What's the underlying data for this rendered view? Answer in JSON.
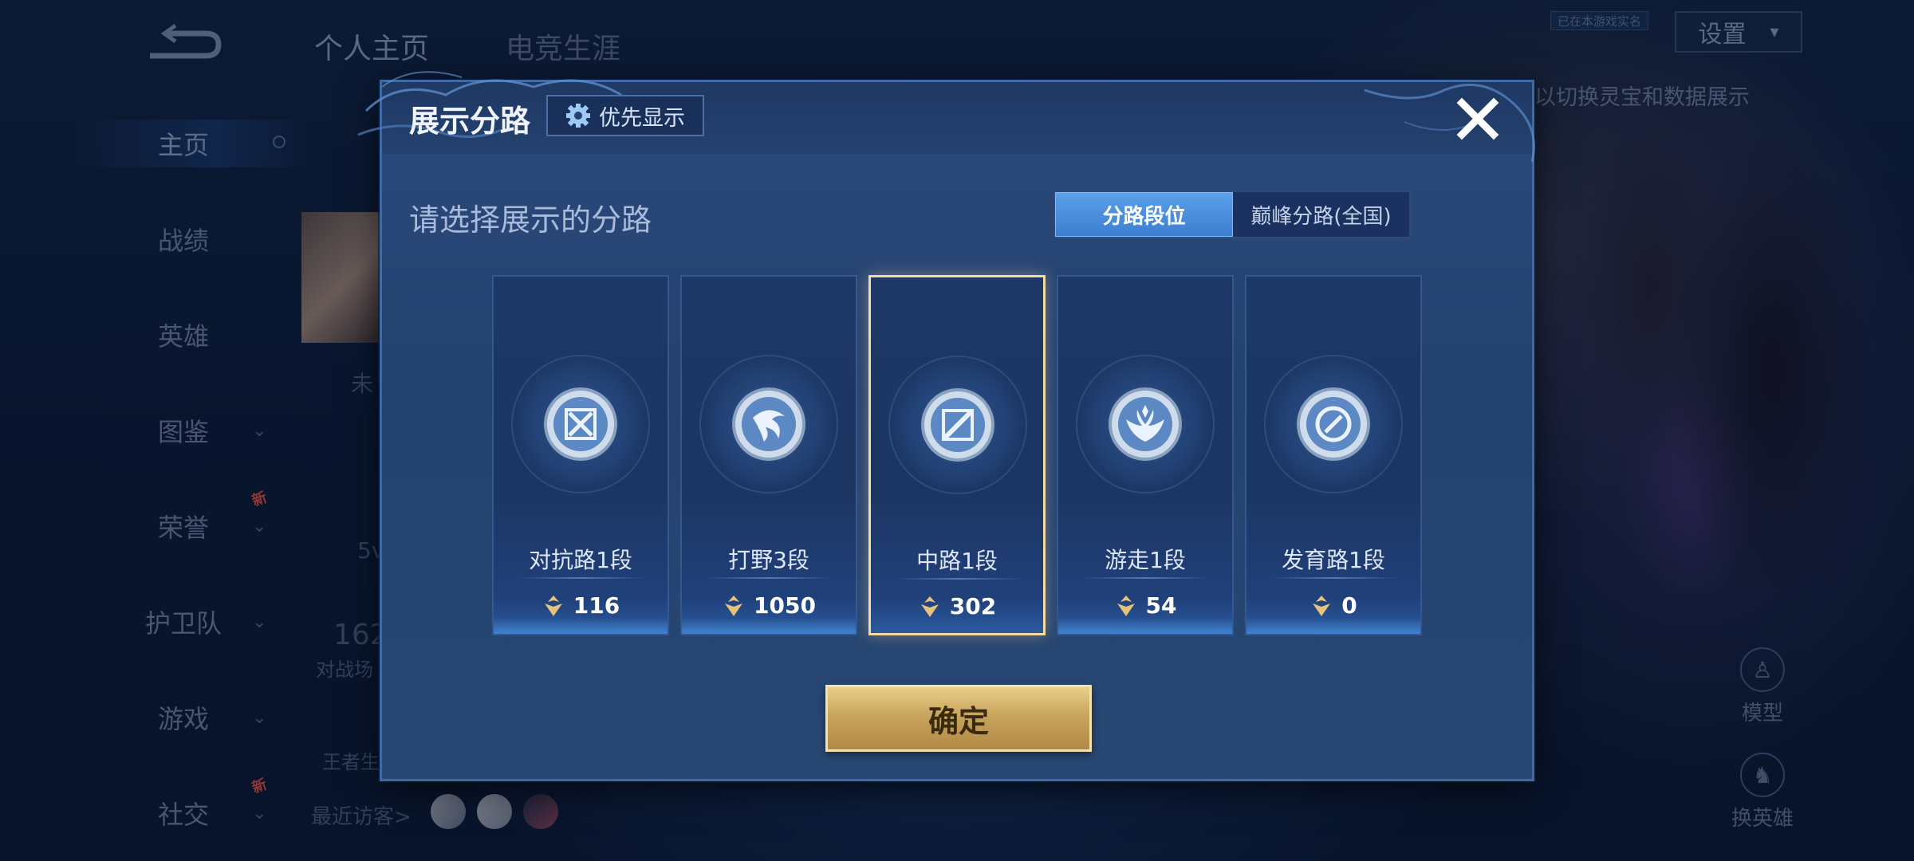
{
  "sidebar": {
    "items": [
      {
        "label": "主页",
        "active": true
      },
      {
        "label": "战绩"
      },
      {
        "label": "英雄"
      },
      {
        "label": "图鉴",
        "has_chevron": true
      },
      {
        "label": "荣誉",
        "has_chevron": true,
        "badge": "新"
      },
      {
        "label": "护卫队",
        "has_chevron": true
      },
      {
        "label": "游戏",
        "has_chevron": true
      },
      {
        "label": "社交",
        "has_chevron": true,
        "badge": "新"
      }
    ]
  },
  "top_tabs": [
    "个人主页",
    "电竞生涯"
  ],
  "header": {
    "settings_label": "设置",
    "small_tag": "已在本游戏实名",
    "tip": "以切换灵宝和数据展示"
  },
  "behind": {
    "peek_1": "未",
    "peek_2": "5v",
    "peek_3": "162",
    "peek_4": "对战场",
    "peek_5": "王者生",
    "recent_visitors": "最近访客>"
  },
  "right_icons": {
    "model": "模型",
    "switch_hero": "换英雄"
  },
  "modal": {
    "title": "展示分路",
    "priority_label": "优先显示",
    "prompt": "请选择展示的分路",
    "segment": {
      "options": [
        "分路段位",
        "巅峰分路(全国)"
      ],
      "selected": "分路段位"
    },
    "lanes": [
      {
        "name": "对抗路1段",
        "points": "116",
        "icon": "sword-lane-icon",
        "selected": false
      },
      {
        "name": "打野3段",
        "points": "1050",
        "icon": "jungle-claw-icon",
        "selected": false
      },
      {
        "name": "中路1段",
        "points": "302",
        "icon": "mid-lane-icon",
        "selected": true
      },
      {
        "name": "游走1段",
        "points": "54",
        "icon": "roam-wings-icon",
        "selected": false
      },
      {
        "name": "发育路1段",
        "points": "0",
        "icon": "farm-lane-icon",
        "selected": false
      }
    ],
    "confirm_label": "确定"
  },
  "colors": {
    "accent_gold": "#f6d9a0",
    "segment_active": "#4a8ee0",
    "modal_bg": "#284874"
  }
}
